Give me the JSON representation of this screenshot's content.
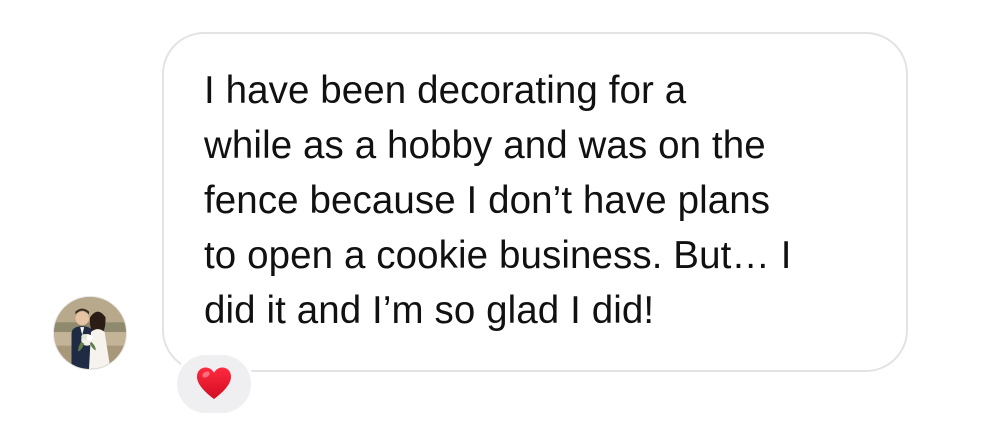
{
  "message": {
    "lines": [
      "I have been decorating for a",
      "while as a hobby and was on the",
      "fence because I don’t have plans",
      "to open a cookie business. But… I",
      "did it and I’m so glad I did!"
    ]
  },
  "sender": {
    "avatar_icon": "profile-photo"
  },
  "reaction": {
    "icon": "red-heart-icon",
    "color": "#e8112d"
  },
  "colors": {
    "bubble_border": "#e3e3e6",
    "reaction_bg": "#efeff1",
    "text": "#111111"
  }
}
